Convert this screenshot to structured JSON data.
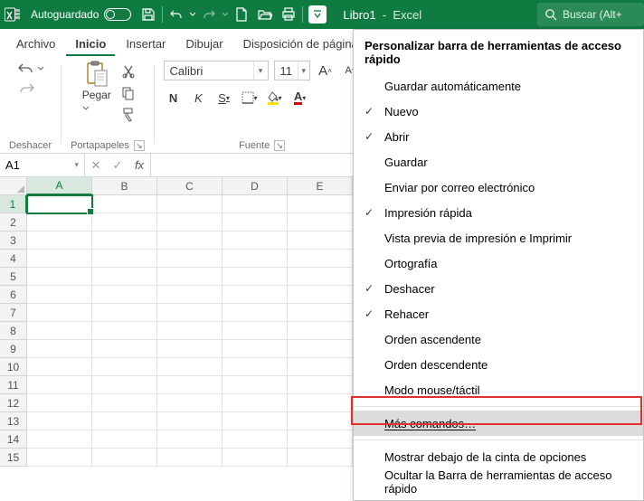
{
  "titlebar": {
    "autosave_label": "Autoguardado",
    "doc_name": "Libro1",
    "app_name": "Excel",
    "search_placeholder": "Buscar (Alt+"
  },
  "tabs": {
    "file": "Archivo",
    "home": "Inicio",
    "insert": "Insertar",
    "draw": "Dibujar",
    "layout": "Disposición de página"
  },
  "ribbon": {
    "undo_group": "Deshacer",
    "clipboard_group": "Portapapeles",
    "paste_label": "Pegar",
    "font_group": "Fuente",
    "font_name": "Calibri",
    "font_size": "11",
    "bold": "N",
    "italic": "K",
    "underline": "S",
    "grow_font": "A",
    "shrink_font": "A"
  },
  "formula_bar": {
    "name_box": "A1",
    "fx_label": "fx"
  },
  "grid": {
    "cols": [
      "A",
      "B",
      "C",
      "D",
      "E"
    ],
    "rows": [
      "1",
      "2",
      "3",
      "4",
      "5",
      "6",
      "7",
      "8",
      "9",
      "10",
      "11",
      "12",
      "13",
      "14",
      "15"
    ]
  },
  "dropdown": {
    "title": "Personalizar barra de herramientas de acceso rápido",
    "items": [
      {
        "label": "Guardar automáticamente",
        "checked": false
      },
      {
        "label": "Nuevo",
        "checked": true
      },
      {
        "label": "Abrir",
        "checked": true
      },
      {
        "label": "Guardar",
        "checked": false
      },
      {
        "label": "Enviar por correo electrónico",
        "checked": false
      },
      {
        "label": "Impresión rápida",
        "checked": true
      },
      {
        "label": "Vista previa de impresión e Imprimir",
        "checked": false
      },
      {
        "label": "Ortografía",
        "checked": false
      },
      {
        "label": "Deshacer",
        "checked": true
      },
      {
        "label": "Rehacer",
        "checked": true
      },
      {
        "label": "Orden ascendente",
        "checked": false
      },
      {
        "label": "Orden descendente",
        "checked": false
      },
      {
        "label": "Modo mouse/táctil",
        "checked": false
      }
    ],
    "more_commands": "Más comandos…",
    "below_ribbon": "Mostrar debajo de la cinta de opciones",
    "hide_qat": "Ocultar la Barra de herramientas de acceso rápido"
  }
}
